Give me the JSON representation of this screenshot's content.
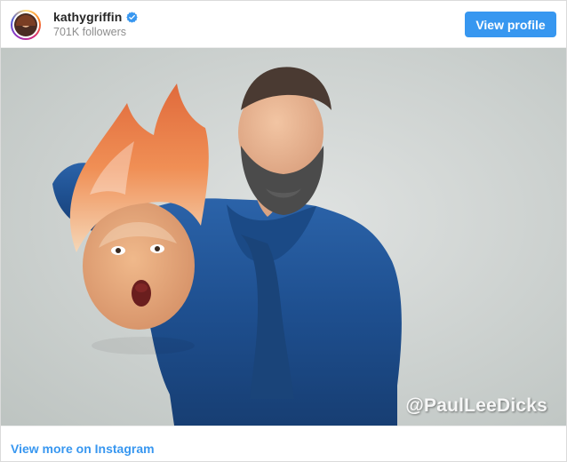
{
  "header": {
    "username": "kathygriffin",
    "followers": "701K followers",
    "view_profile_label": "View profile"
  },
  "icons": {
    "verified": "verified-badge-icon",
    "avatar": "profile-avatar"
  },
  "post": {
    "watermark": "@PaulLeeDicks"
  },
  "footer": {
    "view_more_label": "View more on Instagram"
  },
  "colors": {
    "primary_button": "#3797f0",
    "link": "#3897f0",
    "shirt": "#1f4f8e",
    "background": "#c9ceca"
  }
}
